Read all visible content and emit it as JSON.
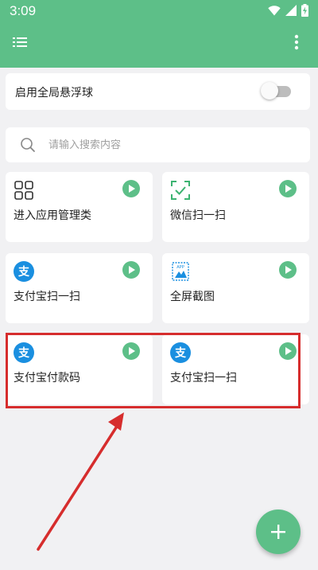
{
  "status_bar": {
    "time": "3:09"
  },
  "toolbar": {
    "menu_icon": "list-icon",
    "more_icon": "more-vert-icon"
  },
  "float_ball": {
    "label": "启用全局悬浮球",
    "enabled": false
  },
  "search": {
    "placeholder": "请输入搜索内容",
    "value": ""
  },
  "shortcuts": [
    {
      "label": "进入应用管理类",
      "icon": "grid-apps-icon"
    },
    {
      "label": "微信扫一扫",
      "icon": "scan-icon"
    },
    {
      "label": "支付宝扫一扫",
      "icon": "alipay-icon"
    },
    {
      "label": "全屏截图",
      "icon": "screenshot-icon"
    },
    {
      "label": "支付宝付款码",
      "icon": "alipay-icon"
    },
    {
      "label": "支付宝扫一扫",
      "icon": "alipay-icon"
    }
  ],
  "alipay_glyph": "支",
  "app_glyph": "APP",
  "colors": {
    "accent": "#5dbf88",
    "alipay": "#1a8fe0",
    "highlight": "#d62d2d"
  },
  "fab": {
    "icon": "plus-icon"
  }
}
